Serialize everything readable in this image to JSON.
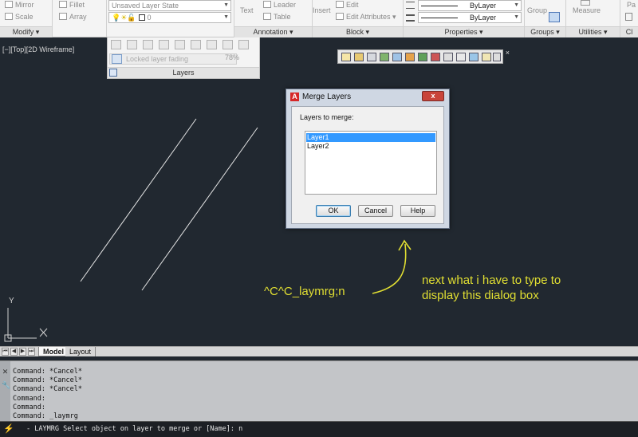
{
  "ribbon": {
    "modify": {
      "items": [
        "Mirror",
        "Fillet",
        "Scale",
        "Array"
      ],
      "footer": "Modify"
    },
    "layers": {
      "layer_state": "Unsaved Layer State",
      "current_layer": "0",
      "locked_fading_label": "Locked layer fading",
      "locked_fading_value": "78%",
      "footer": "Layers"
    },
    "annotation": {
      "items": [
        "Text",
        "Leader",
        "Table"
      ],
      "footer": "Annotation"
    },
    "block": {
      "items": [
        "Insert",
        "Edit",
        "Edit Attributes"
      ],
      "footer": "Block"
    },
    "properties": {
      "linetype": "ByLayer",
      "lineweight": "ByLayer",
      "footer": "Properties"
    },
    "groups": {
      "items": [
        "Group"
      ],
      "footer": "Groups"
    },
    "utilities": {
      "items": [
        "Measure"
      ],
      "footer": "Utilities"
    },
    "clipboard": {
      "items": [
        "Pa"
      ],
      "footer": "Cl"
    }
  },
  "viewport": {
    "label": "[−][Top][2D Wireframe]"
  },
  "dialog": {
    "title": "Merge Layers",
    "app_icon_letter": "A",
    "close_label": "x",
    "list_label": "Layers to merge:",
    "layers": [
      "Layer1",
      "Layer2"
    ],
    "selected_index": 0,
    "ok_label": "OK",
    "cancel_label": "Cancel",
    "help_label": "Help"
  },
  "annotations": {
    "command_text": "^C^C_laymrg;n",
    "note_line1": "next what i have to type to",
    "note_line2": "display this dialog box"
  },
  "ucs": {
    "y_label": "Y"
  },
  "layout_tabs": {
    "model": "Model",
    "layout": "Layout"
  },
  "command_window": {
    "history": [
      "Command: *Cancel*",
      "Command: *Cancel*",
      "Command: *Cancel*",
      "Command:",
      "Command:",
      "Command: _laymrg"
    ],
    "prompt_command": "- LAYMRG",
    "prompt_text": "Select object on layer to merge or [Name]: n"
  },
  "colors": {
    "canvas": "#212830",
    "annotation_yellow": "#e1df32",
    "selection_blue": "#3399ff",
    "close_red": "#c9443a"
  }
}
